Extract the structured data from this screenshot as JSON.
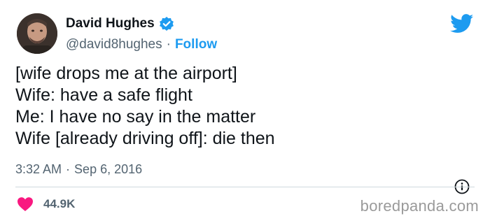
{
  "author": {
    "name": "David Hughes",
    "handle": "@david8hughes",
    "separator": "·",
    "follow_label": "Follow"
  },
  "tweet": {
    "lines": [
      "[wife drops me at the airport]",
      "Wife: have a safe flight",
      "Me: I have no say in the matter",
      "Wife [already driving off]: die then"
    ],
    "time": "3:32 AM",
    "separator": "·",
    "date": "Sep 6, 2016"
  },
  "stats": {
    "likes": "44.9K"
  },
  "watermark": "boredpanda.com",
  "icons": {
    "verified": "verified-badge-icon",
    "platform": "twitter-bird-icon",
    "info": "info-icon",
    "like": "heart-icon"
  },
  "colors": {
    "accent": "#1d9bf0",
    "heart": "#f91880",
    "muted": "#536471"
  }
}
